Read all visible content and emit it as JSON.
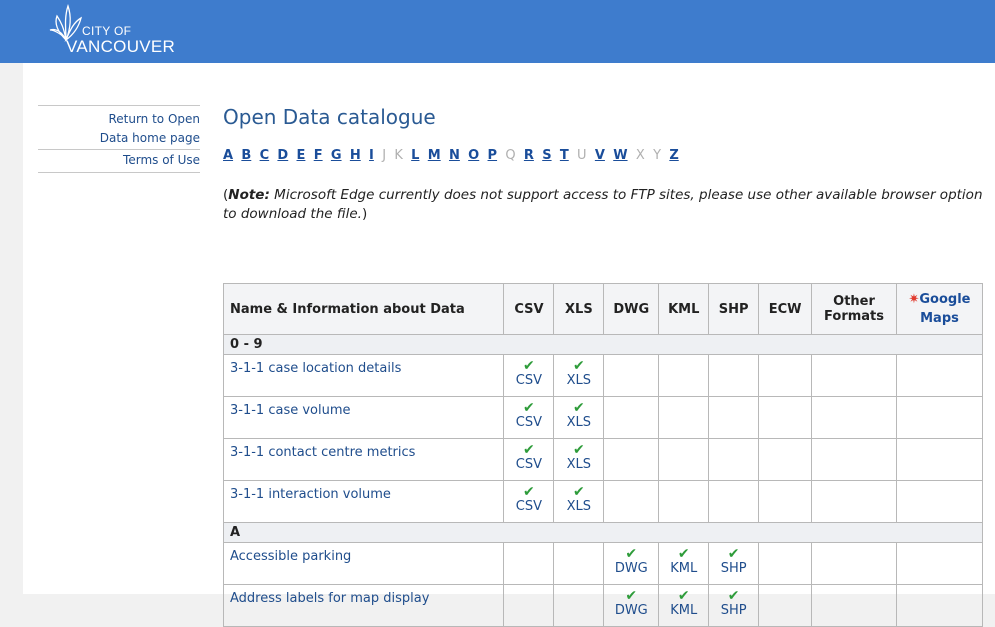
{
  "header": {
    "logo_line1": "CITY OF",
    "logo_line2": "VANCOUVER"
  },
  "sidebar": {
    "items": [
      {
        "label": "Return to Open Data home page"
      },
      {
        "label": "Terms of Use"
      }
    ]
  },
  "main": {
    "title": "Open Data catalogue",
    "alphabet": [
      {
        "letter": "A",
        "active": true
      },
      {
        "letter": "B",
        "active": true
      },
      {
        "letter": "C",
        "active": true
      },
      {
        "letter": "D",
        "active": true
      },
      {
        "letter": "E",
        "active": true
      },
      {
        "letter": "F",
        "active": true
      },
      {
        "letter": "G",
        "active": true
      },
      {
        "letter": "H",
        "active": true
      },
      {
        "letter": "I",
        "active": true
      },
      {
        "letter": "J",
        "active": false
      },
      {
        "letter": "K",
        "active": false
      },
      {
        "letter": "L",
        "active": true
      },
      {
        "letter": "M",
        "active": true
      },
      {
        "letter": "N",
        "active": true
      },
      {
        "letter": "O",
        "active": true
      },
      {
        "letter": "P",
        "active": true
      },
      {
        "letter": "Q",
        "active": false
      },
      {
        "letter": "R",
        "active": true
      },
      {
        "letter": "S",
        "active": true
      },
      {
        "letter": "T",
        "active": true
      },
      {
        "letter": "U",
        "active": false
      },
      {
        "letter": "V",
        "active": true
      },
      {
        "letter": "W",
        "active": true
      },
      {
        "letter": "X",
        "active": false
      },
      {
        "letter": "Y",
        "active": false
      },
      {
        "letter": "Z",
        "active": true
      }
    ],
    "note_prefix": "Note:",
    "note_text": " Microsoft Edge currently does not support access to FTP sites, please use other available browser option to download the file."
  },
  "table": {
    "headers": {
      "name": "Name & Information about Data",
      "csv": "CSV",
      "xls": "XLS",
      "dwg": "DWG",
      "kml": "KML",
      "shp": "SHP",
      "ecw": "ECW",
      "other_line1": "Other",
      "other_line2": "Formats",
      "gmaps_line1": "Google",
      "gmaps_line2": "Maps"
    },
    "sections": [
      {
        "label": "0 - 9",
        "rows": [
          {
            "name": "3-1-1 case location details",
            "formats": [
              "CSV",
              "XLS"
            ]
          },
          {
            "name": "3-1-1 case volume",
            "formats": [
              "CSV",
              "XLS"
            ]
          },
          {
            "name": "3-1-1 contact centre metrics",
            "formats": [
              "CSV",
              "XLS"
            ]
          },
          {
            "name": "3-1-1 interaction volume",
            "formats": [
              "CSV",
              "XLS"
            ]
          }
        ]
      },
      {
        "label": "A",
        "rows": [
          {
            "name": "Accessible parking",
            "formats": [
              "DWG",
              "KML",
              "SHP"
            ]
          },
          {
            "name": "Address labels for map display",
            "formats": [
              "DWG",
              "KML",
              "SHP"
            ]
          }
        ]
      }
    ],
    "check_glyph": "✔",
    "star_glyph": "✷"
  }
}
